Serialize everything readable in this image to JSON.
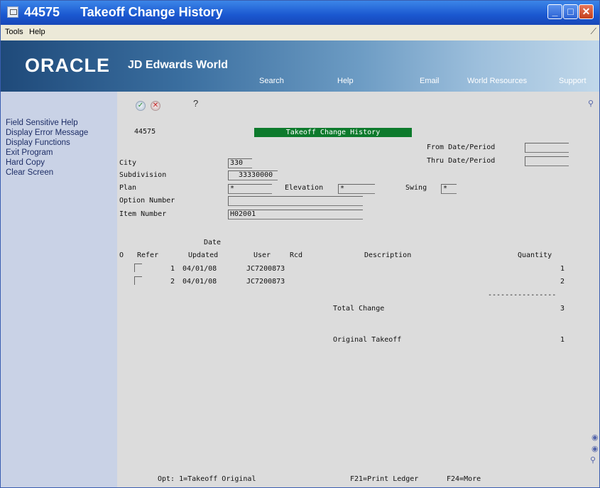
{
  "window": {
    "number": "44575",
    "title": "Takeoff Change History"
  },
  "menubar": {
    "items": [
      "Tools",
      "Help"
    ]
  },
  "banner": {
    "logo_oracle": "ORACLE",
    "logo_jde": "JD Edwards World",
    "links": [
      "Search",
      "Help",
      "Email",
      "World Resources",
      "Support"
    ]
  },
  "left_menu": {
    "items": [
      "Field Sensitive Help",
      "Display Error Message",
      "Display Functions",
      "Exit Program",
      "Hard Copy",
      "Clear Screen"
    ]
  },
  "toolbar": {
    "ok_symbol": "✓",
    "cancel_symbol": "✕",
    "help_symbol": "?"
  },
  "form": {
    "program_number": "44575",
    "header_title": "Takeoff Change History",
    "from_date_label": "From Date/Period",
    "thru_date_label": "Thru Date/Period",
    "city_label": "City",
    "city_value": "330",
    "subdivision_label": "Subdivision",
    "subdivision_value": "33330000",
    "plan_label": "Plan",
    "plan_value": "*",
    "elevation_label": "Elevation",
    "elevation_value": "*",
    "swing_label": "Swing",
    "swing_value": "*",
    "option_label": "Option Number",
    "option_value": "",
    "item_label": "Item Number",
    "item_value": "H02001"
  },
  "table": {
    "header_line1": "Date",
    "columns": [
      "O",
      "Refer",
      "Updated",
      "User",
      "Rcd",
      "Description",
      "Quantity"
    ],
    "rows": [
      {
        "refer": "1",
        "date": "04/01/08",
        "user": "JC7200873",
        "quantity": "1"
      },
      {
        "refer": "2",
        "date": "04/01/08",
        "user": "JC7200873",
        "quantity": "2"
      }
    ],
    "separator": "----------------",
    "total_change_label": "Total Change",
    "total_change_value": "3",
    "original_takeoff_label": "Original Takeoff",
    "original_takeoff_value": "1"
  },
  "footer": {
    "options": "Opt: 1=Takeoff Original",
    "f21": "F21=Print Ledger",
    "f24": "F24=More"
  }
}
